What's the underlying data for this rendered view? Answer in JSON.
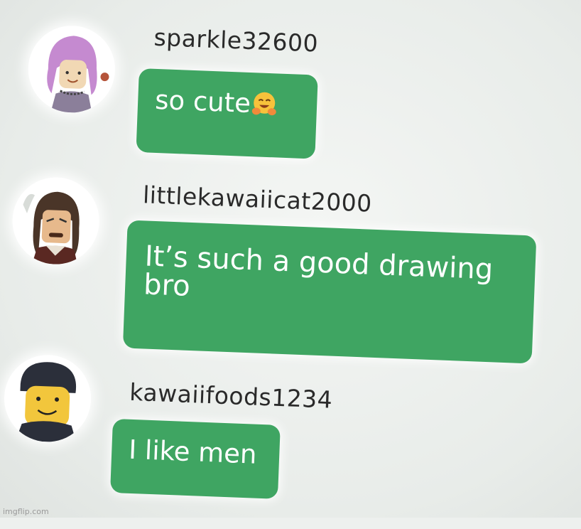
{
  "messages": [
    {
      "username": "sparkle32600",
      "text": "so cute",
      "emoji": "smiling-face-with-open-hands"
    },
    {
      "username": "littlekawaiicat2000",
      "text": "It’s such a good drawing bro"
    },
    {
      "username": "kawaiifoods1234",
      "text": "I like men"
    }
  ],
  "watermark": "imgflip.com",
  "colors": {
    "bubble": "#3fa562",
    "text": "#2a2a2a",
    "background": "#edf0ee"
  }
}
